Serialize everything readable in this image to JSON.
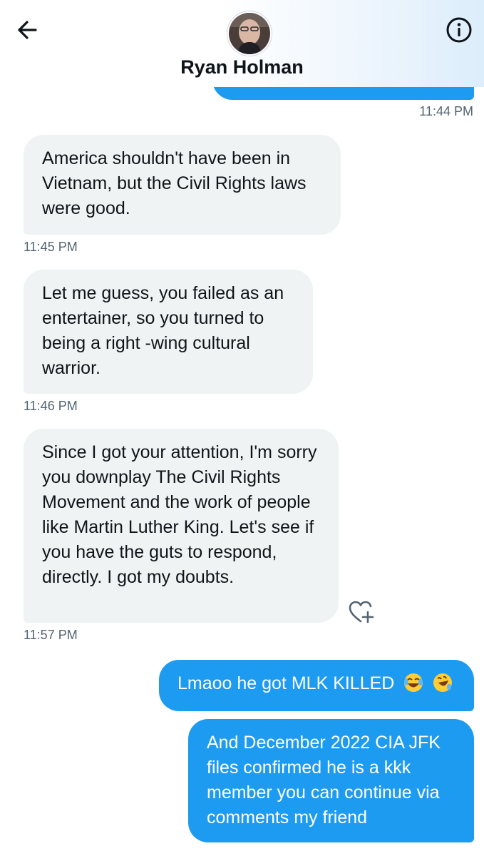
{
  "header": {
    "contact_name": "Ryan Holman",
    "back_icon": "arrow-left-icon",
    "info_icon": "info-circle-icon"
  },
  "colors": {
    "outgoing_bubble": "#1d9bf0",
    "incoming_bubble": "#eff3f4",
    "timestamp": "#536471"
  },
  "messages": [
    {
      "direction": "outgoing",
      "text": "",
      "time": "11:44 PM"
    },
    {
      "direction": "incoming",
      "text": "America shouldn't have been in Vietnam, but the Civil Rights laws were good.",
      "time": "11:45 PM"
    },
    {
      "direction": "incoming",
      "text": "Let me guess, you failed as an entertainer, so you turned to being a right -wing cultural warrior.",
      "time": "11:46 PM"
    },
    {
      "direction": "incoming",
      "text": "Since I got your attention, I'm sorry you downplay The Civil Rights Movement and the work of people like Martin Luther King. Let's see if you have the guts to respond, directly. I got my doubts.",
      "time": "11:57 PM",
      "reaction_icon": "heart-plus-icon"
    },
    {
      "direction": "outgoing",
      "text": "Lmaoo he got MLK KILLED",
      "emojis": [
        "face-with-tears-of-joy",
        "rolling-on-floor-laughing"
      ]
    },
    {
      "direction": "outgoing",
      "text": "And December 2022 CIA JFK files confirmed he is a kkk member you can continue via comments my friend"
    }
  ]
}
